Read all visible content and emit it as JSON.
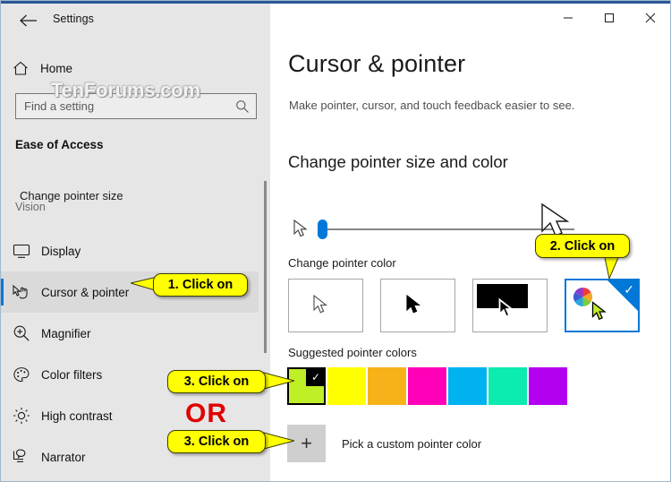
{
  "window": {
    "title": "Settings",
    "accent_color": "#0078d7",
    "back_icon": "back-arrow-icon",
    "controls": {
      "minimize_label": "─",
      "maximize_label": "□",
      "close_label": "✕"
    }
  },
  "watermark": {
    "text": "TenForums.com"
  },
  "sidebar": {
    "home": {
      "label": "Home",
      "icon": "home-icon"
    },
    "search": {
      "placeholder": "Find a setting",
      "value": "",
      "icon": "search-icon"
    },
    "category": "Ease of Access",
    "group_label": "Vision",
    "items": [
      {
        "label": "Display",
        "icon": "monitor-icon",
        "selected": false
      },
      {
        "label": "Cursor & pointer",
        "icon": "cursor-hand-icon",
        "selected": true
      },
      {
        "label": "Magnifier",
        "icon": "magnifier-icon",
        "selected": false
      },
      {
        "label": "Color filters",
        "icon": "palette-icon",
        "selected": false
      },
      {
        "label": "High contrast",
        "icon": "brightness-icon",
        "selected": false
      },
      {
        "label": "Narrator",
        "icon": "narrator-icon",
        "selected": false
      }
    ]
  },
  "main": {
    "page_title": "Cursor & pointer",
    "page_subtitle": "Make pointer, cursor, and touch feedback easier to see.",
    "section_heading": "Change pointer size and color",
    "pointer_size": {
      "label": "Change pointer size",
      "value": 1,
      "min": 1,
      "max": 15
    },
    "pointer_color": {
      "label": "Change pointer color",
      "options": [
        {
          "name": "white-pointer",
          "selected": false
        },
        {
          "name": "black-pointer",
          "selected": false
        },
        {
          "name": "inverted-pointer",
          "selected": false
        },
        {
          "name": "custom-color-pointer",
          "selected": true
        }
      ]
    },
    "suggested_colors": {
      "label": "Suggested pointer colors",
      "swatches": [
        {
          "color": "#bfef26",
          "selected": true
        },
        {
          "color": "#ffff00",
          "selected": false
        },
        {
          "color": "#f7b219",
          "selected": false
        },
        {
          "color": "#ff00b8",
          "selected": false
        },
        {
          "color": "#00b2f0",
          "selected": false
        },
        {
          "color": "#0cebb0",
          "selected": false
        },
        {
          "color": "#b300f0",
          "selected": false
        }
      ]
    },
    "custom_color": {
      "button_icon": "plus-icon",
      "button_label": "+",
      "label": "Pick a custom pointer color"
    }
  },
  "annotations": {
    "step1": "1. Click on",
    "step2": "2. Click on",
    "step3a": "3. Click on",
    "step3b": "3. Click on",
    "or": "OR",
    "callout_color": "#ffff00",
    "or_color": "#e00000"
  }
}
